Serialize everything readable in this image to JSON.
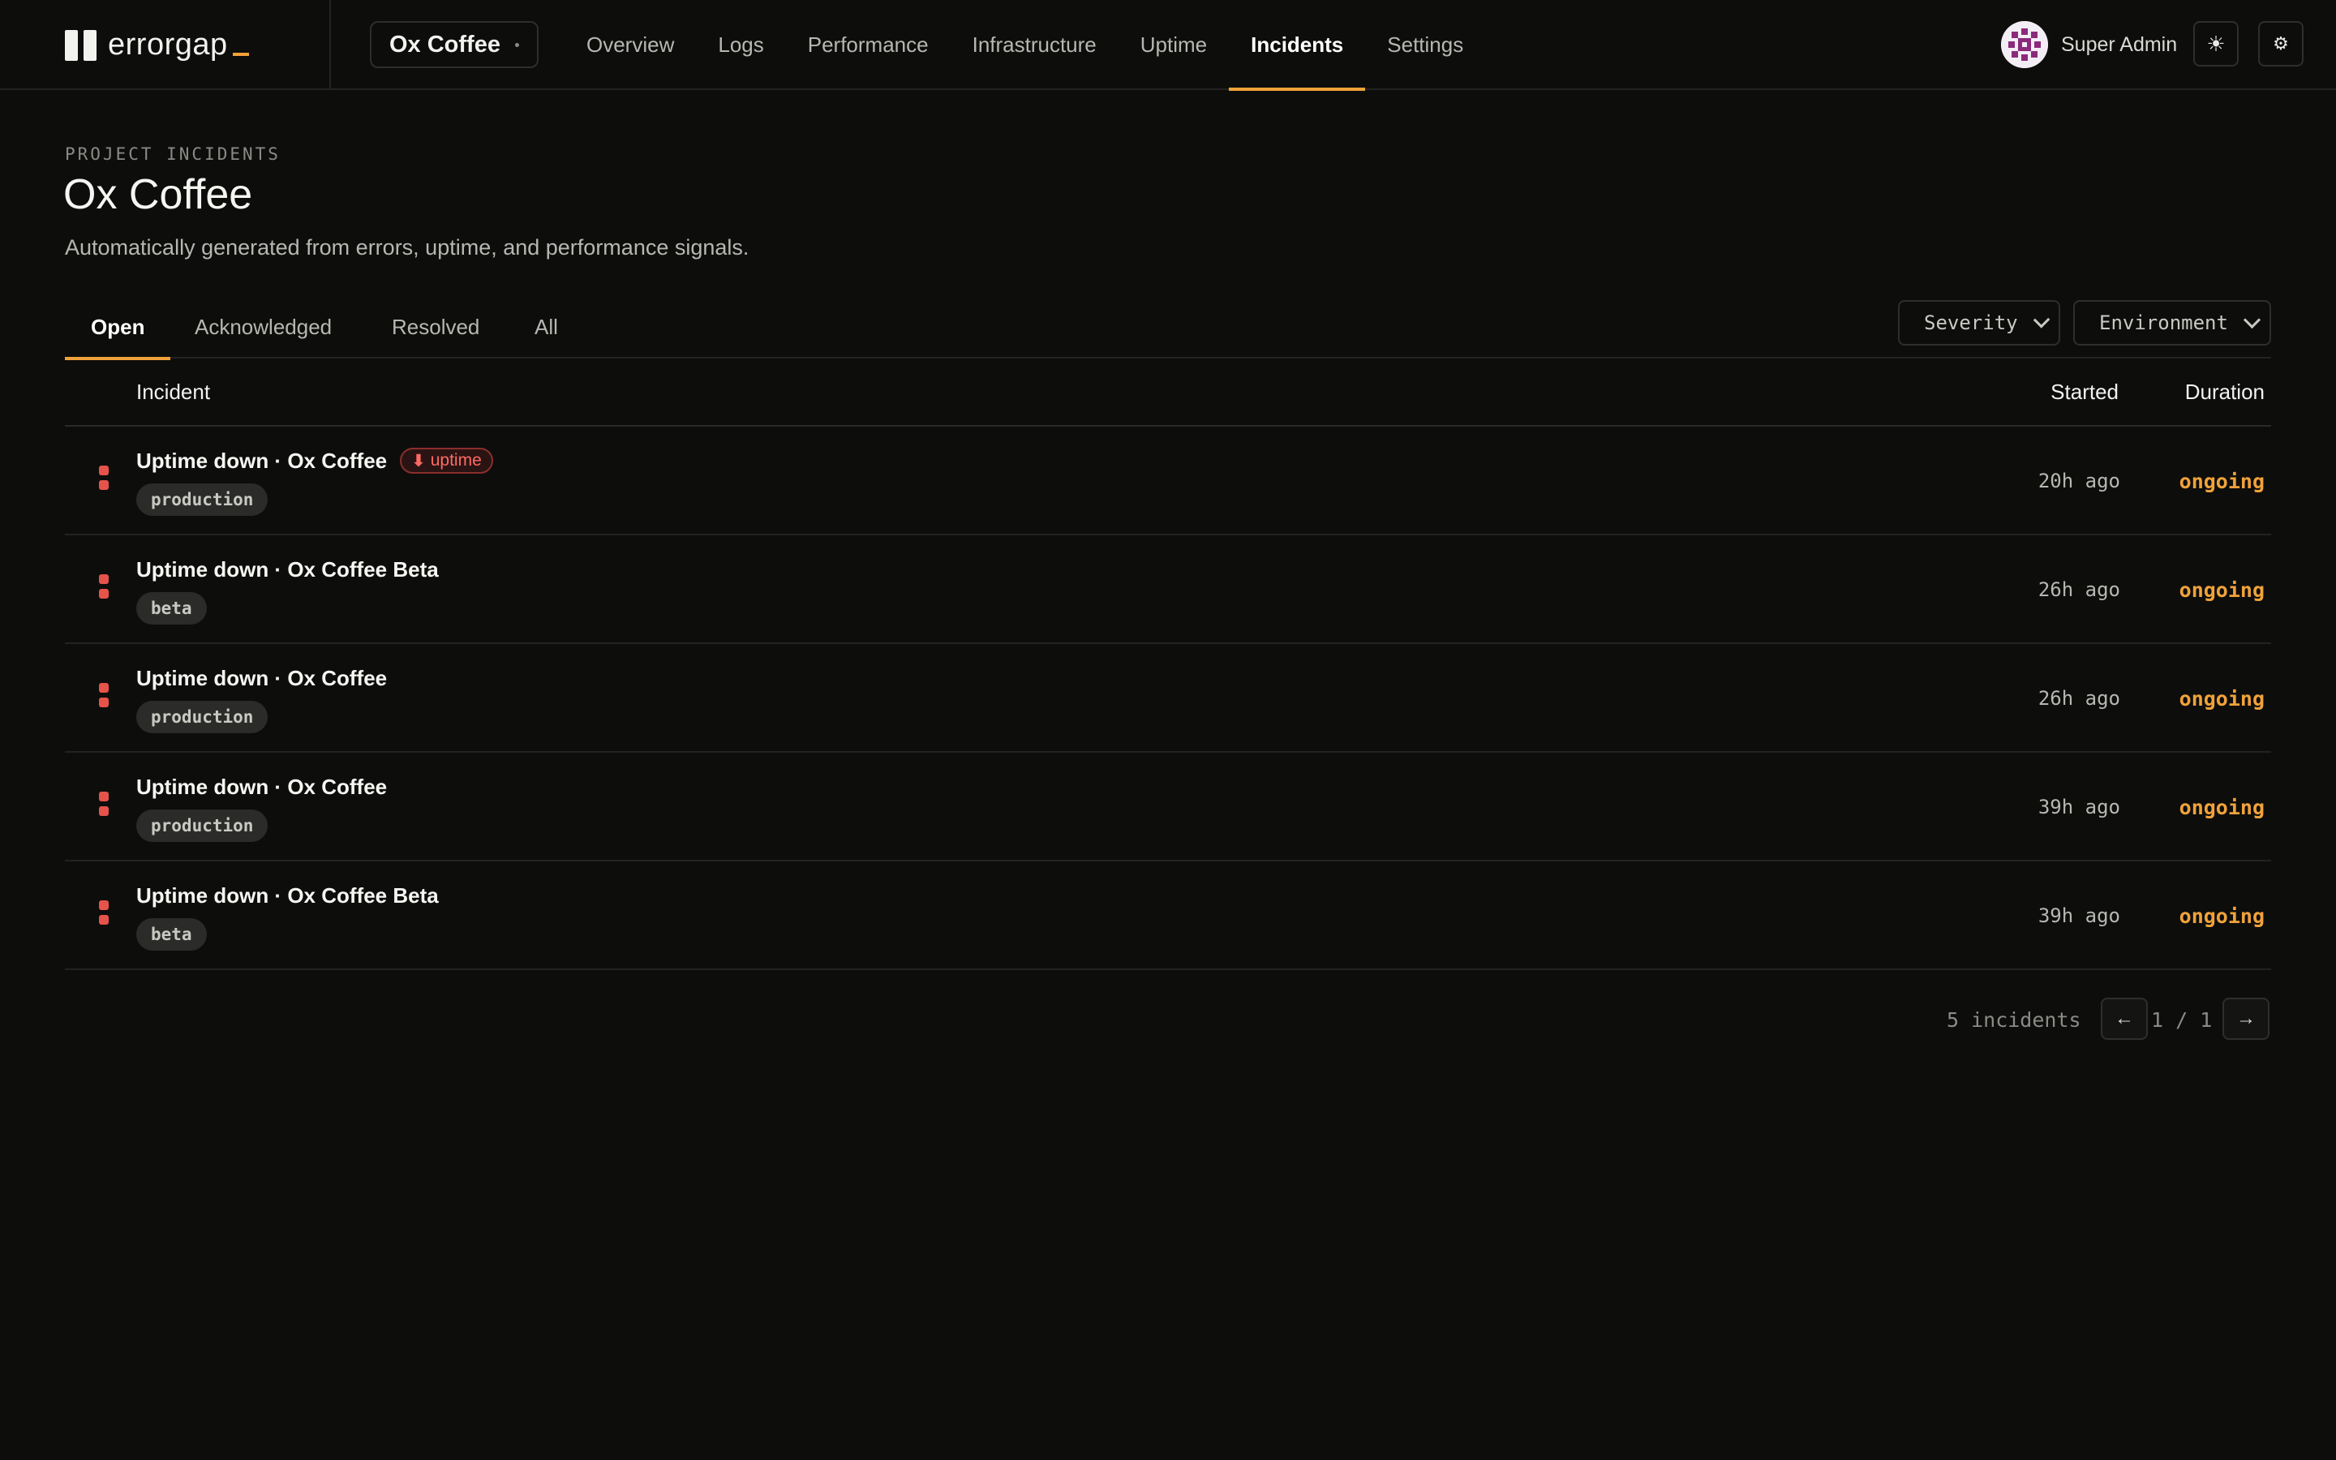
{
  "brand": {
    "name": "errorgap",
    "logo_icon": "errorgap-logo-icon"
  },
  "project_selector": {
    "label": "Ox Coffee"
  },
  "nav": [
    {
      "label": "Overview",
      "active": false
    },
    {
      "label": "Logs",
      "active": false
    },
    {
      "label": "Performance",
      "active": false
    },
    {
      "label": "Infrastructure",
      "active": false
    },
    {
      "label": "Uptime",
      "active": false
    },
    {
      "label": "Incidents",
      "active": true
    },
    {
      "label": "Settings",
      "active": false
    }
  ],
  "user": {
    "name": "Super Admin",
    "avatar_icon": "identicon-avatar"
  },
  "actions": {
    "theme_icon": "☀",
    "settings_icon": "⚙"
  },
  "header": {
    "eyebrow": "PROJECT INCIDENTS",
    "title": "Ox Coffee",
    "description": "Automatically generated from errors, uptime, and performance signals."
  },
  "tabs": [
    {
      "label": "Open",
      "active": true
    },
    {
      "label": "Acknowledged",
      "active": false
    },
    {
      "label": "Resolved",
      "active": false
    },
    {
      "label": "All",
      "active": false
    }
  ],
  "filters": {
    "severity": "Severity",
    "environment": "Environment"
  },
  "table": {
    "columns": {
      "incident": "Incident",
      "started": "Started",
      "duration": "Duration"
    },
    "rows": [
      {
        "title": "Uptime down · Ox Coffee",
        "badge": "uptime",
        "env": "production",
        "started": "20h ago",
        "duration": "ongoing"
      },
      {
        "title": "Uptime down · Ox Coffee Beta",
        "badge": "",
        "env": "beta",
        "started": "26h ago",
        "duration": "ongoing"
      },
      {
        "title": "Uptime down · Ox Coffee",
        "badge": "",
        "env": "production",
        "started": "26h ago",
        "duration": "ongoing"
      },
      {
        "title": "Uptime down · Ox Coffee",
        "badge": "",
        "env": "production",
        "started": "39h ago",
        "duration": "ongoing"
      },
      {
        "title": "Uptime down · Ox Coffee Beta",
        "badge": "",
        "env": "beta",
        "started": "39h ago",
        "duration": "ongoing"
      }
    ]
  },
  "footer": {
    "count": "5 incidents",
    "page": "1",
    "pages": "1",
    "prev_icon": "←",
    "next_icon": "→"
  },
  "colors": {
    "accent": "#f0a23a",
    "danger": "#e5534b",
    "background": "#0d0d0c"
  }
}
